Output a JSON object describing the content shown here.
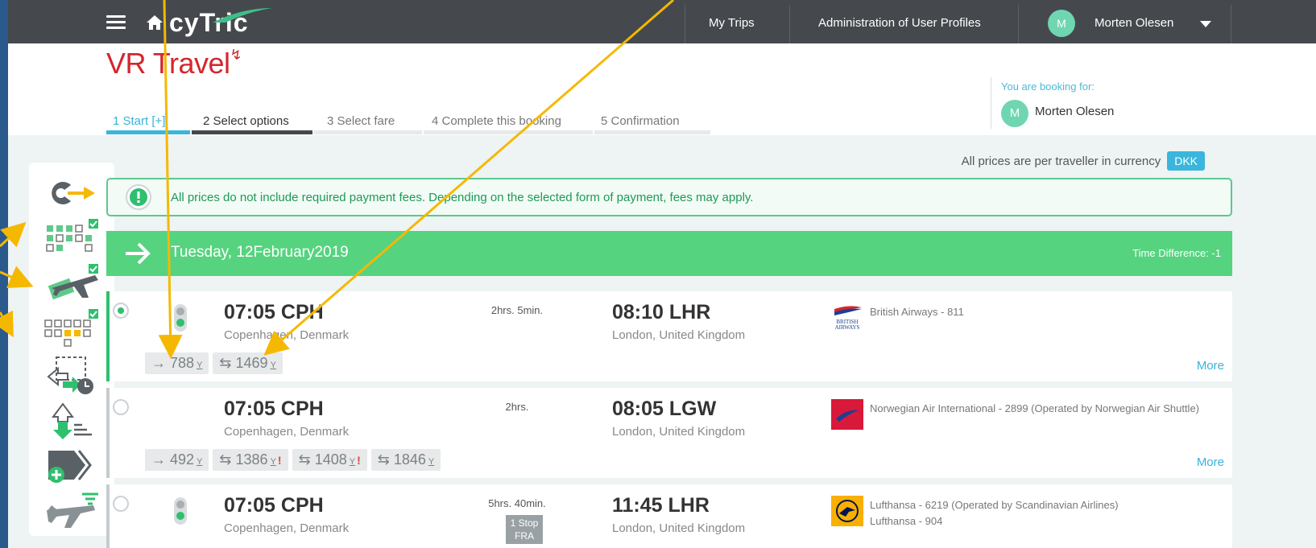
{
  "topbar": {
    "brand": "cyTric",
    "nav": [
      "My Trips",
      "Administration of User Profiles"
    ],
    "user_initial": "M",
    "user_name": "Morten Olesen"
  },
  "header": {
    "logo_text": "VR Travel",
    "booking_for_label": "You are booking for:",
    "booking_for_initial": "M",
    "booking_for_name": "Morten Olesen"
  },
  "steps": [
    {
      "label": "1  Start  [+]",
      "state": "done"
    },
    {
      "label": "2  Select options",
      "state": "active"
    },
    {
      "label": "3  Select fare",
      "state": "todo"
    },
    {
      "label": "4  Complete this booking",
      "state": "todo"
    },
    {
      "label": "5  Confirmation",
      "state": "todo"
    }
  ],
  "price_note": "All prices are per traveller in currency",
  "currency": "DKK",
  "alert": "All prices do not include required payment fees. Depending on the selected form of payment, fees may apply.",
  "date_bar": {
    "date": "Tuesday, 12February2019",
    "time_difference": "Time Difference: -1"
  },
  "flights": [
    {
      "selected": true,
      "dep": "07:05 CPH",
      "dep_city": "Copenhagen, Denmark",
      "duration": "2hrs. 5min.",
      "stop": "",
      "arr": "08:10 LHR",
      "arr_city": "London, United Kingdom",
      "carrier_lines": [
        "British Airways - 811"
      ],
      "logo": "british-airways-logo",
      "more": "More",
      "fares": [
        {
          "dir": "→",
          "price": "788",
          "cls": "Y",
          "warn": false
        },
        {
          "dir": "⇆",
          "price": "1469",
          "cls": "Y",
          "warn": false
        }
      ]
    },
    {
      "selected": false,
      "dep": "07:05 CPH",
      "dep_city": "Copenhagen, Denmark",
      "duration": "2hrs.",
      "stop": "",
      "arr": "08:05 LGW",
      "arr_city": "London, United Kingdom",
      "carrier_lines": [
        "Norwegian Air International - 2899 (Operated by Norwegian Air Shuttle)"
      ],
      "logo": "norwegian-logo",
      "more": "More",
      "fares": [
        {
          "dir": "→",
          "price": "492",
          "cls": "Y",
          "warn": false
        },
        {
          "dir": "⇆",
          "price": "1386",
          "cls": "Y",
          "warn": true
        },
        {
          "dir": "⇆",
          "price": "1408",
          "cls": "Y",
          "warn": true
        },
        {
          "dir": "⇆",
          "price": "1846",
          "cls": "Y",
          "warn": false
        }
      ]
    },
    {
      "selected": false,
      "dep": "07:05 CPH",
      "dep_city": "Copenhagen, Denmark",
      "duration": "5hrs. 40min.",
      "stop": "1 Stop FRA",
      "arr": "11:45 LHR",
      "arr_city": "London, United Kingdom",
      "carrier_lines": [
        "Lufthansa - 6219 (Operated by Scandinavian Airlines)",
        "Lufthansa - 904"
      ],
      "logo": "lufthansa-logo",
      "more": "",
      "fares": []
    }
  ],
  "colors": {
    "topbar": "#45494d",
    "accent_blue": "#3ab6dc",
    "green": "#56d37f",
    "brand_red": "#d4262e",
    "annotation": "#f5b800"
  },
  "sidebar_icons": [
    "change-search-icon",
    "seat-map-icon",
    "flight-cash-icon",
    "cabin-layout-icon",
    "schedule-icon",
    "sort-download-icon",
    "add-segment-icon",
    "flight-filter-icon"
  ]
}
